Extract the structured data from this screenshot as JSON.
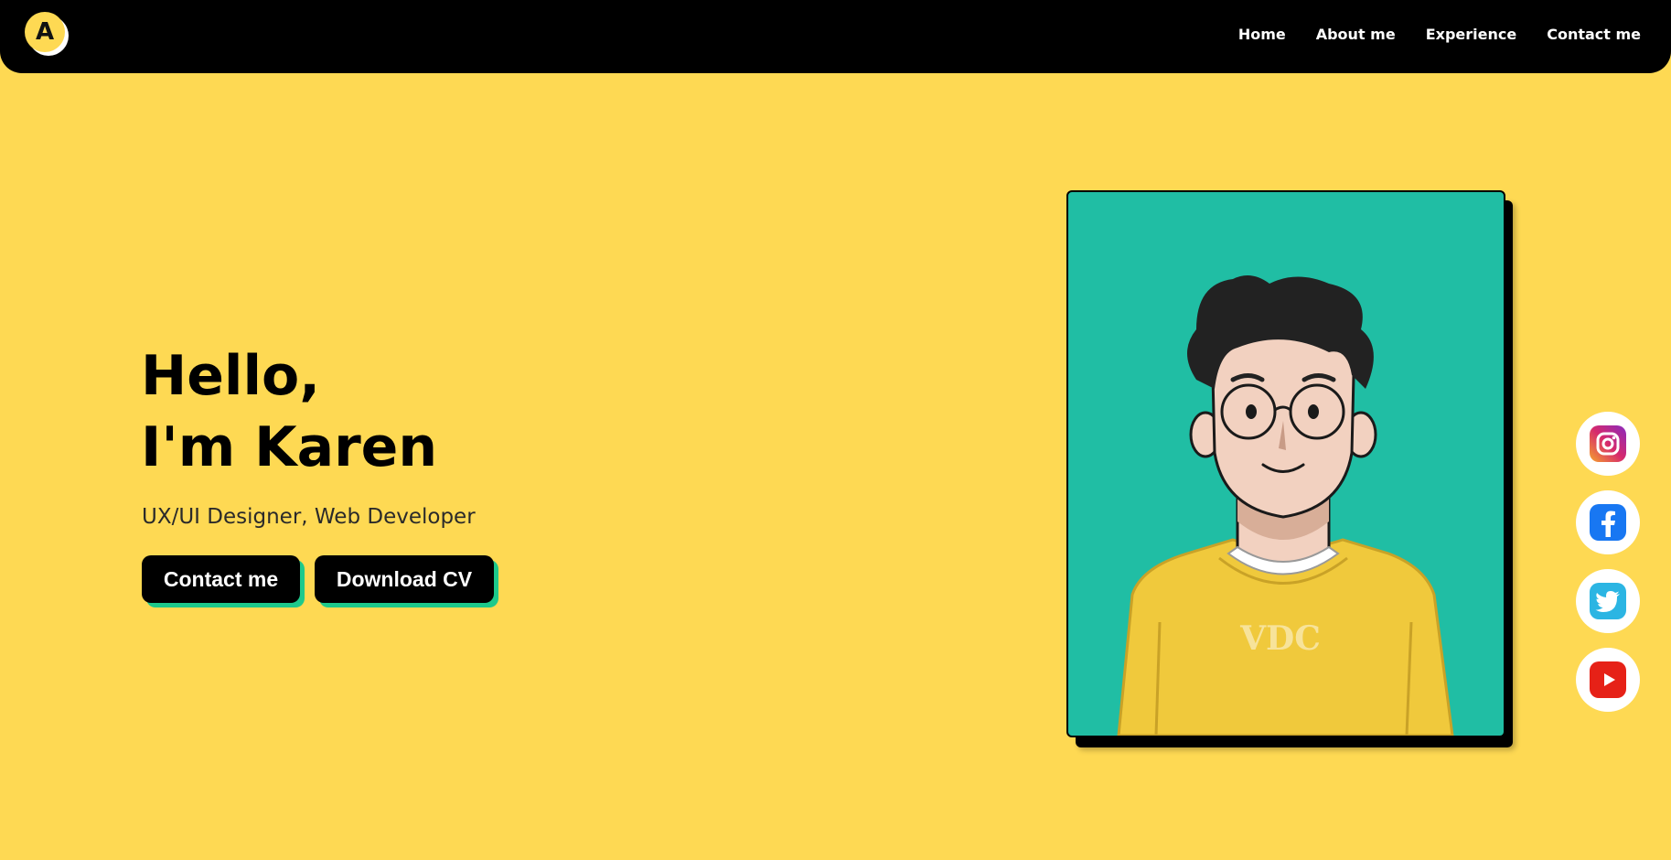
{
  "navbar": {
    "logo_letter": "A",
    "links": [
      "Home",
      "About me",
      "Experience",
      "Contact me"
    ]
  },
  "hero": {
    "greeting": "Hello,",
    "name_line": "I'm Karen",
    "subtitle": "UX/UI Designer, Web Developer",
    "buttons": {
      "contact": "Contact me",
      "download": "Download CV"
    }
  },
  "portrait": {
    "shirt_text": "VDC"
  },
  "social": {
    "icons": [
      "instagram-icon",
      "facebook-icon",
      "twitter-icon",
      "youtube-icon"
    ]
  },
  "colors": {
    "background": "#FED953",
    "navbar": "#000000",
    "button_shadow": "#1DC98B",
    "portrait_bg": "#20BEA4"
  }
}
